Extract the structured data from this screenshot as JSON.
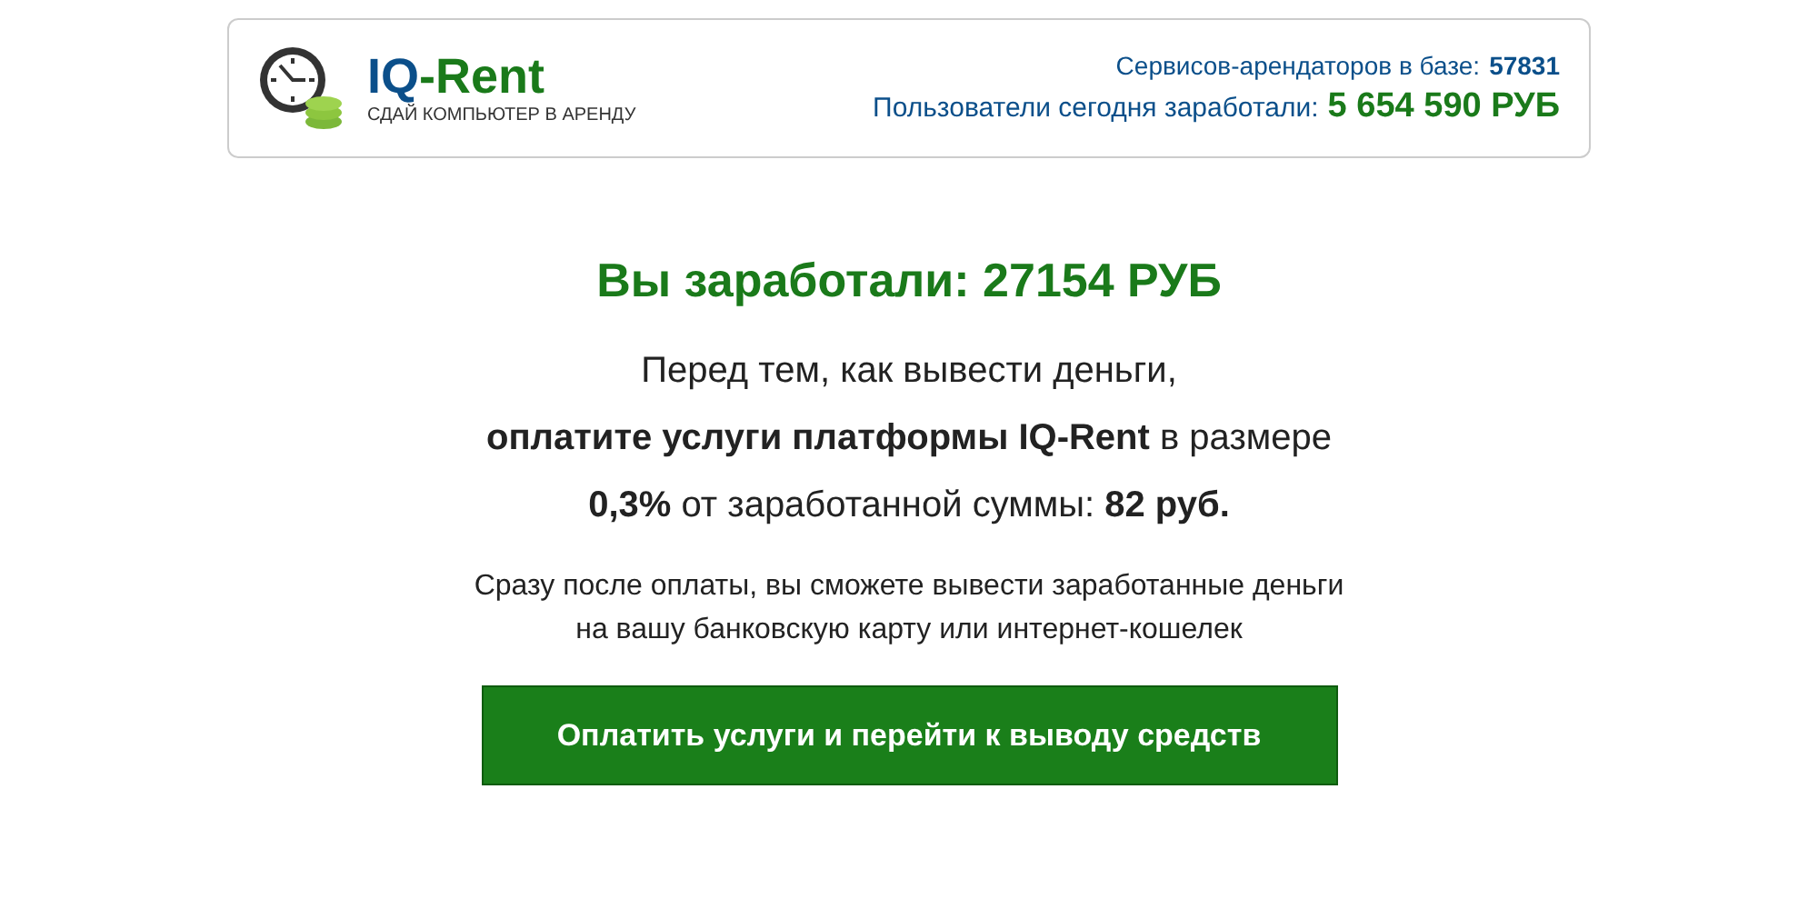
{
  "header": {
    "logo": {
      "part_1": "IQ",
      "part_2": "-Rent",
      "tagline": "СДАЙ КОМПЬЮТЕР В АРЕНДУ"
    },
    "stats": [
      {
        "label": "Сервисов-арендаторов в базе:",
        "value": "57831",
        "kind": "small"
      },
      {
        "label": "Пользователи сегодня заработали:",
        "value": "5 654 590 РУБ",
        "kind": "large"
      }
    ]
  },
  "main": {
    "title": "Вы заработали: 27154 РУБ",
    "notice": "Перед тем, как вывести деньги,\n**оплатите услуги платформы IQ-Rent** в размере\n**0,3%** от заработанной суммы: **82 руб.**",
    "info": "Сразу после оплаты, вы сможете вывести заработанные деньги\nна вашу банковскую карту или интернет-кошелек",
    "button": "Оплатить услуги и перейти к выводу средств"
  }
}
